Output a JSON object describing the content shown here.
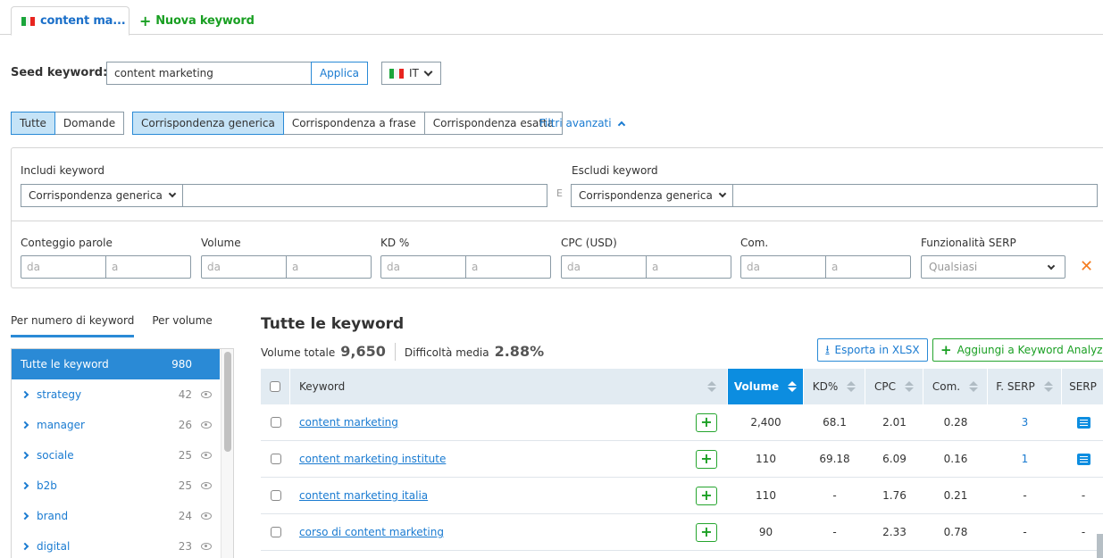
{
  "tabs": {
    "active_label": "content ma...",
    "new_label": "Nuova keyword"
  },
  "seed": {
    "label": "Seed keyword:",
    "value": "content marketing",
    "apply_label": "Applica",
    "database": "IT"
  },
  "type_filter": {
    "options": [
      "Tutte",
      "Domande"
    ],
    "selected": "Tutte"
  },
  "match_filter": {
    "options": [
      "Corrispondenza generica",
      "Corrispondenza a frase",
      "Corrispondenza esatta"
    ],
    "selected": "Corrispondenza generica"
  },
  "advanced_filters_label": "Filtri avanzati",
  "filters": {
    "include_label": "Includi keyword",
    "include_match": "Corrispondenza generica",
    "include_value": "",
    "and_separator": "E",
    "exclude_label": "Escludi keyword",
    "exclude_match": "Corrispondenza generica",
    "exclude_value": "",
    "ranges": [
      {
        "label": "Conteggio parole",
        "from_placeholder": "da",
        "to_placeholder": "a"
      },
      {
        "label": "Volume",
        "from_placeholder": "da",
        "to_placeholder": "a"
      },
      {
        "label": "KD %",
        "from_placeholder": "da",
        "to_placeholder": "a"
      },
      {
        "label": "CPC (USD)",
        "from_placeholder": "da",
        "to_placeholder": "a"
      },
      {
        "label": "Com.",
        "from_placeholder": "da",
        "to_placeholder": "a"
      }
    ],
    "serp_label": "Funzionalità SERP",
    "serp_value": "Qualsiasi",
    "clear_icon": "close-icon"
  },
  "sidebar": {
    "tabs": [
      "Per numero di keyword",
      "Per volume"
    ],
    "active_tab": "Per numero di keyword",
    "items": [
      {
        "label": "Tutte le keyword",
        "count": "980",
        "active": true
      },
      {
        "label": "strategy",
        "count": "42"
      },
      {
        "label": "manager",
        "count": "26"
      },
      {
        "label": "sociale",
        "count": "25"
      },
      {
        "label": "b2b",
        "count": "25"
      },
      {
        "label": "brand",
        "count": "24"
      },
      {
        "label": "digital",
        "count": "23"
      }
    ]
  },
  "main": {
    "title": "Tutte le keyword",
    "total_volume_label": "Volume totale",
    "total_volume": "9,650",
    "avg_difficulty_label": "Difficoltà media",
    "avg_difficulty": "2.88%",
    "export_label": "Esporta in XLSX",
    "add_label": "Aggiungi a Keyword Analyzer",
    "columns": [
      "Keyword",
      "Volume",
      "KD%",
      "CPC",
      "Com.",
      "F. SERP",
      "SERP"
    ],
    "sorted_column": "Volume",
    "rows": [
      {
        "keyword": "content marketing",
        "volume": "2,400",
        "kd": "68.1",
        "cpc": "2.01",
        "com": "0.28",
        "fserp": "3",
        "serp": "icon"
      },
      {
        "keyword": "content marketing institute",
        "volume": "110",
        "kd": "69.18",
        "cpc": "6.09",
        "com": "0.16",
        "fserp": "1",
        "serp": "icon"
      },
      {
        "keyword": "content marketing italia",
        "volume": "110",
        "kd": "-",
        "cpc": "1.76",
        "com": "0.21",
        "fserp": "-",
        "serp": "-"
      },
      {
        "keyword": "corso di content marketing",
        "volume": "90",
        "kd": "-",
        "cpc": "2.33",
        "com": "0.78",
        "fserp": "-",
        "serp": "-"
      }
    ]
  },
  "colors": {
    "accent": "#2a8ad6",
    "green": "#199f22",
    "orange": "#f57c1f",
    "header_bg": "#e2ebf2"
  }
}
